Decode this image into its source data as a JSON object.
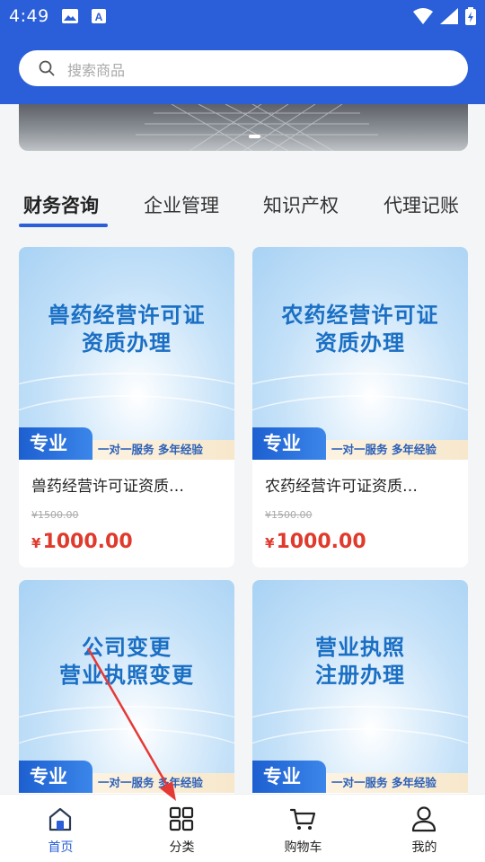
{
  "status_bar": {
    "time": "4:49"
  },
  "search": {
    "placeholder": "搜索商品"
  },
  "tabs": [
    {
      "label": "财务咨询",
      "active": true
    },
    {
      "label": "企业管理",
      "active": false
    },
    {
      "label": "知识产权",
      "active": false
    },
    {
      "label": "代理记账",
      "active": false
    }
  ],
  "products": [
    {
      "image_title_line1": "兽药经营许可证",
      "image_title_line2": "资质办理",
      "badge": "专业",
      "tagline": "一对一服务  多年经验",
      "name": "兽药经营许可证资质…",
      "old_price": "¥1500.00",
      "currency": "¥",
      "price": "1000.00"
    },
    {
      "image_title_line1": "农药经营许可证",
      "image_title_line2": "资质办理",
      "badge": "专业",
      "tagline": "一对一服务  多年经验",
      "name": "农药经营许可证资质…",
      "old_price": "¥1500.00",
      "currency": "¥",
      "price": "1000.00"
    },
    {
      "image_title_line1": "公司变更",
      "image_title_line2": "营业执照变更",
      "badge": "专业",
      "tagline": "一对一服务  多年经验"
    },
    {
      "image_title_line1": "营业执照",
      "image_title_line2": "注册办理",
      "badge": "专业",
      "tagline": "一对一服务  多年经验"
    }
  ],
  "bottom_nav": [
    {
      "label": "首页",
      "icon": "home-icon",
      "active": true
    },
    {
      "label": "分类",
      "icon": "grid-icon",
      "active": false
    },
    {
      "label": "购物车",
      "icon": "cart-icon",
      "active": false
    },
    {
      "label": "我的",
      "icon": "user-icon",
      "active": false
    }
  ],
  "colors": {
    "primary": "#2b5fd9",
    "price": "#e03a2c",
    "annotation_arrow": "#e53935"
  }
}
